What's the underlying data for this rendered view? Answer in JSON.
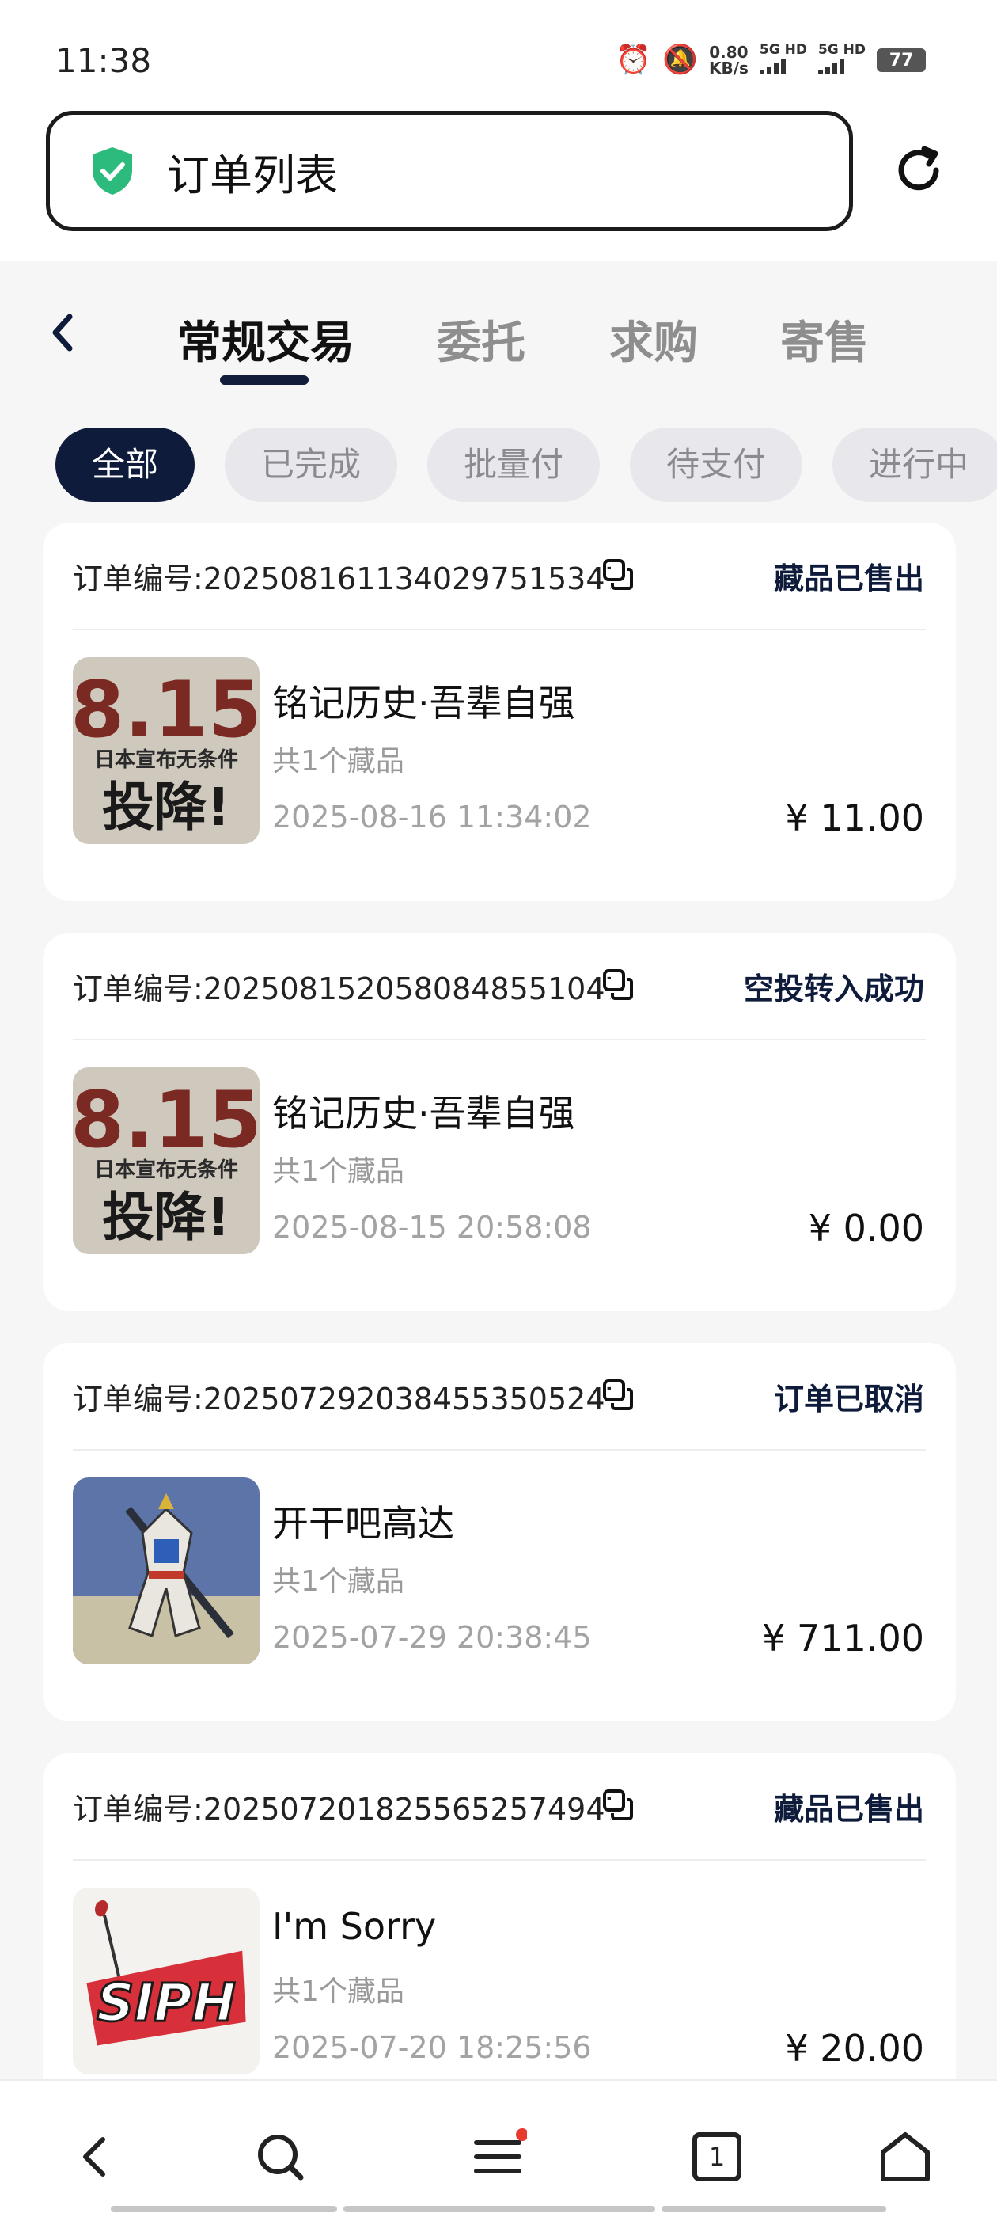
{
  "status_bar": {
    "time": "11:38",
    "speed_value": "0.80",
    "speed_unit": "KB/s",
    "sim1": "5G HD",
    "sim2": "5G HD",
    "battery": "77"
  },
  "address_bar": {
    "title": "订单列表"
  },
  "tabs": [
    {
      "label": "常规交易",
      "active": true
    },
    {
      "label": "委托",
      "active": false
    },
    {
      "label": "求购",
      "active": false
    },
    {
      "label": "寄售",
      "active": false
    }
  ],
  "filters": [
    "全部",
    "已完成",
    "批量付",
    "待支付",
    "进行中"
  ],
  "orders": [
    {
      "order_no": "订单编号:2025081611340297515347…",
      "status": "藏品已售出",
      "name": "铭记历史·吾辈自强",
      "count": "共1个藏品",
      "date": "2025-08-16 11:34:02",
      "price": "¥ 11.00",
      "thumb": "815"
    },
    {
      "order_no": "订单编号:2025081520580848551047…",
      "status": "空投转入成功",
      "name": "铭记历史·吾辈自强",
      "count": "共1个藏品",
      "date": "2025-08-15 20:58:08",
      "price": "¥ 0.00",
      "thumb": "815"
    },
    {
      "order_no": "订单编号:2025072920384553505247…",
      "status": "订单已取消",
      "name": "开干吧高达",
      "count": "共1个藏品",
      "date": "2025-07-29 20:38:45",
      "price": "¥ 711.00",
      "thumb": "gundam"
    },
    {
      "order_no": "订单编号:2025072018255652574947…",
      "status": "藏品已售出",
      "name": "I'm Sorry",
      "count": "共1个藏品",
      "date": "2025-07-20 18:25:56",
      "price": "¥ 20.00",
      "thumb": "sorry"
    }
  ],
  "thumb_text": {
    "big": "8.15",
    "line": "日本宣布无条件",
    "bottom": "投降!",
    "sorry": "SIPH"
  },
  "bottom_nav": {
    "tabs_count": "1",
    "icons": [
      "back-icon",
      "search-icon",
      "menu-icon",
      "tabs-icon",
      "home-icon"
    ]
  },
  "colors": {
    "accent": "#0e1b3a",
    "shield": "#2dbb7d",
    "notify_dot": "#e8392f"
  }
}
